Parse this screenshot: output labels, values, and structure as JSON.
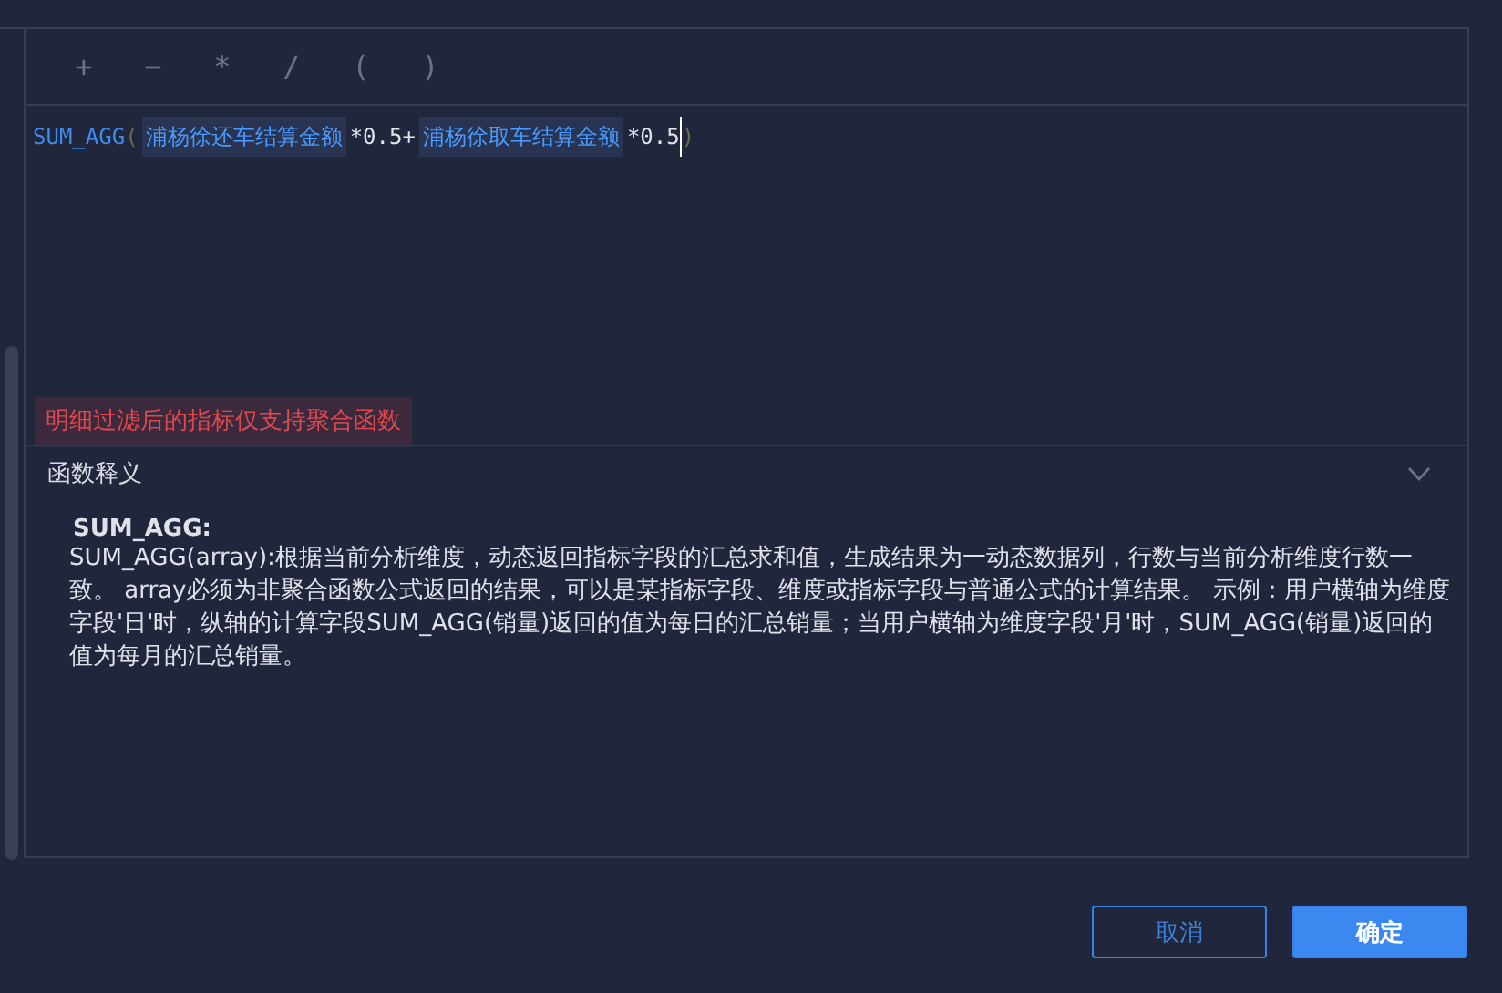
{
  "operators": [
    "+",
    "−",
    "*",
    "/",
    "(",
    ")"
  ],
  "formula": [
    {
      "kind": "function",
      "text": "SUM_AGG"
    },
    {
      "kind": "paren",
      "text": "("
    },
    {
      "kind": "field",
      "text": "浦杨徐还车结算金额"
    },
    {
      "kind": "text",
      "text": "*0.5+"
    },
    {
      "kind": "field",
      "text": "浦杨徐取车结算金额"
    },
    {
      "kind": "text",
      "text": "*0.5"
    },
    {
      "kind": "cursor"
    },
    {
      "kind": "paren",
      "text": ")"
    }
  ],
  "error": "明细过滤后的指标仅支持聚合函数",
  "explanation": {
    "title": "函数释义",
    "expanded": true,
    "name": "SUM_AGG:",
    "body": "SUM_AGG(array):根据当前分析维度，动态返回指标字段的汇总求和值，生成结果为一动态数据列，行数与当前分析维度行数一致。  array必须为非聚合函数公式返回的结果，可以是某指标字段、维度或指标字段与普通公式的计算结果。  示例：用户横轴为维度字段'日'时，纵轴的计算字段SUM_AGG(销量)返回的值为每日的汇总销量；当用户横轴为维度字段'月'时，SUM_AGG(销量)返回的值为每月的汇总销量。"
  },
  "buttons": [
    {
      "kind": "secondary",
      "label": "取消"
    },
    {
      "kind": "primary",
      "label": "确定"
    }
  ]
}
